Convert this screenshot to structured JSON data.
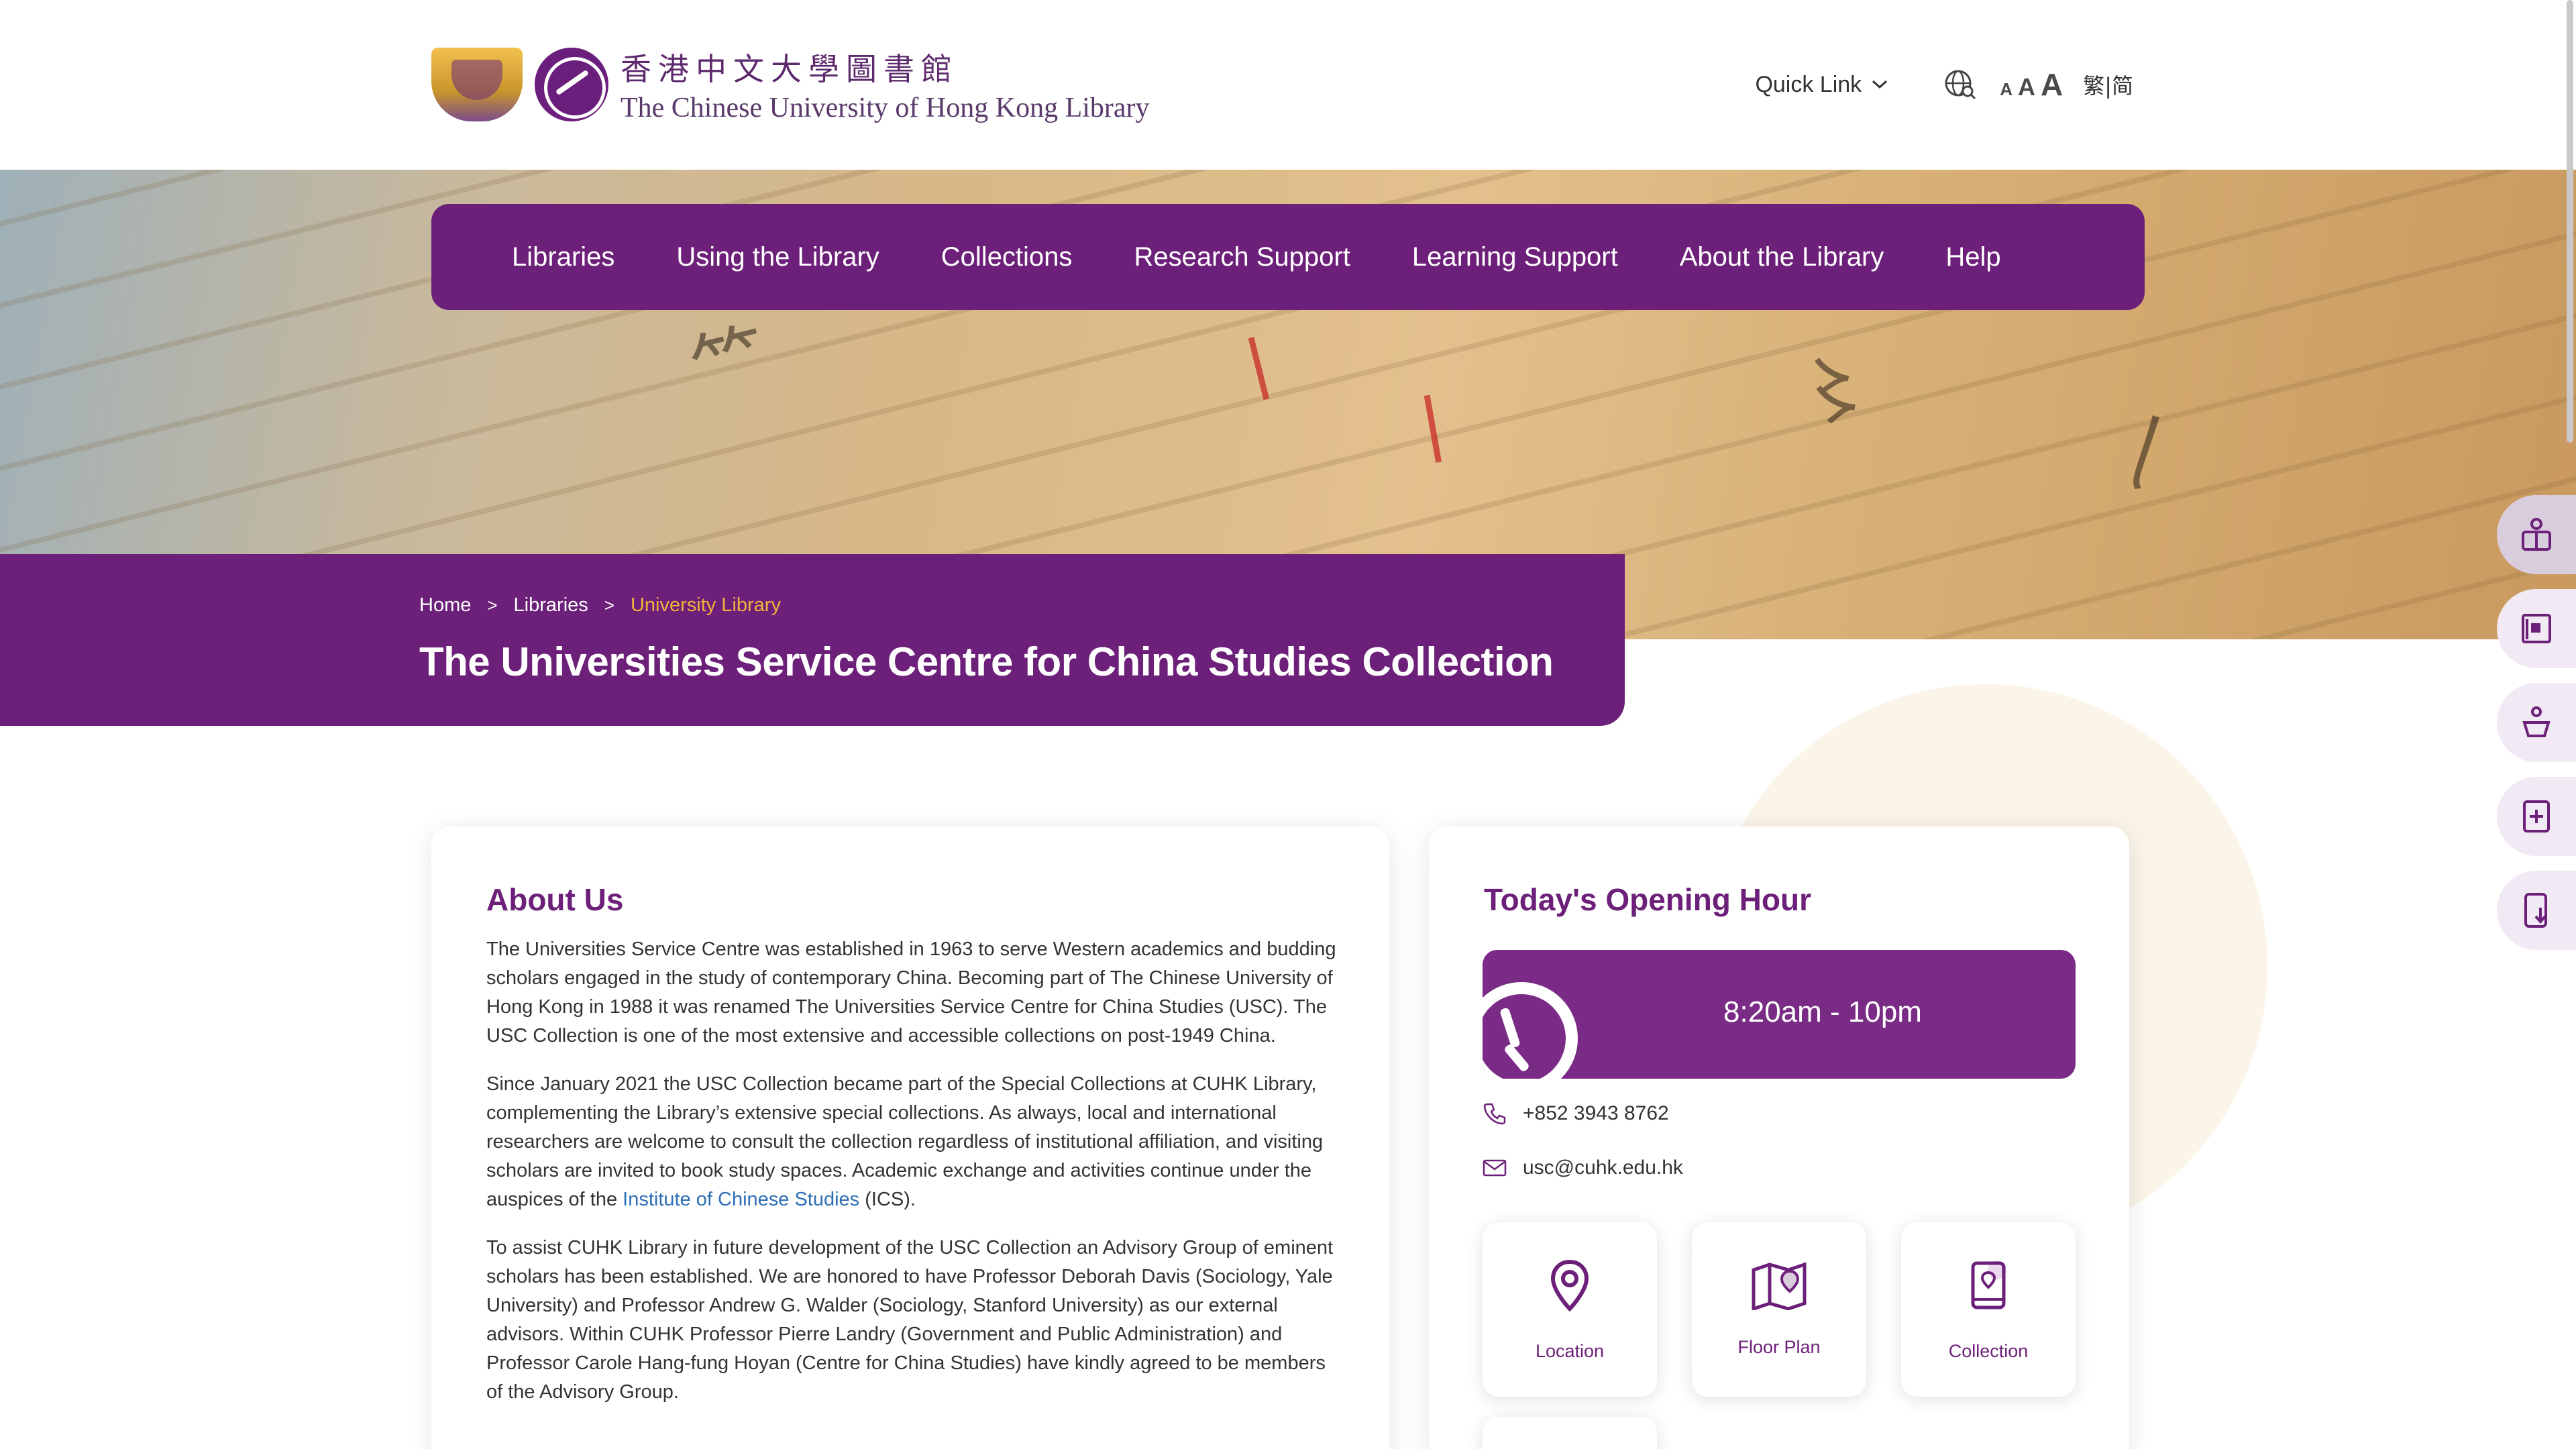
{
  "header": {
    "logo_cn": "香港中文大學圖書館",
    "logo_en": "The Chinese University of Hong Kong Library",
    "quick_link": "Quick Link",
    "font_small": "A",
    "font_medium": "A",
    "font_large": "A",
    "lang_switch": "繁|简"
  },
  "nav": {
    "items": [
      {
        "label": "Libraries"
      },
      {
        "label": "Using the Library"
      },
      {
        "label": "Collections"
      },
      {
        "label": "Research Support"
      },
      {
        "label": "Learning Support"
      },
      {
        "label": "About the Library"
      },
      {
        "label": "Help"
      }
    ]
  },
  "breadcrumb": {
    "home": "Home",
    "sep": ">",
    "libraries": "Libraries",
    "current": "University Library"
  },
  "page_title": "The Universities Service Centre for China Studies Collection",
  "about": {
    "title": "About Us",
    "p1": "The Universities Service Centre was established in 1963 to serve Western academics and budding scholars engaged in the study of contemporary China. Becoming part of The Chinese University of Hong Kong in 1988 it was renamed The Universities Service Centre for China Studies (USC). The USC Collection is one of the most extensive and accessible collections on post-1949 China.",
    "p2_before": "Since January 2021 the USC Collection became part of the Special Collections at CUHK Library, complementing the Library’s extensive special collections. As always, local and international researchers are welcome to consult the collection regardless of institutional affiliation, and visiting scholars are invited to book study spaces. Academic exchange and activities continue under the auspices of the ",
    "p2_link": "Institute of Chinese Studies",
    "p2_after": " (ICS).",
    "p3": "To assist CUHK Library in future development of the USC Collection an Advisory Group of eminent scholars has been established. We are honored to have Professor Deborah Davis (Sociology, Yale University) and Professor Andrew G. Walder (Sociology, Stanford University) as our external advisors. Within CUHK Professor Pierre Landry (Government and Public Administration) and Professor Carole Hang-fung Hoyan (Centre for China Studies) have kindly agreed to be members of the Advisory Group."
  },
  "hours": {
    "title": "Today's Opening Hour",
    "time": "8:20am - 10pm",
    "phone": "+852 3943 8762",
    "email": "usc@cuhk.edu.hk",
    "tiles": [
      {
        "label": "Location",
        "icon": "map-pin-icon"
      },
      {
        "label": "Floor Plan",
        "icon": "floor-plan-icon"
      },
      {
        "label": "Collection",
        "icon": "collection-book-icon"
      }
    ]
  },
  "floating_tools": [
    {
      "icon": "accessibility-icon"
    },
    {
      "icon": "booking-icon"
    },
    {
      "icon": "person-service-icon"
    },
    {
      "icon": "add-book-icon"
    },
    {
      "icon": "mobile-download-icon"
    }
  ],
  "colors": {
    "primary": "#6d2079",
    "accent": "#f3b33d",
    "link": "#2e6fb5"
  }
}
